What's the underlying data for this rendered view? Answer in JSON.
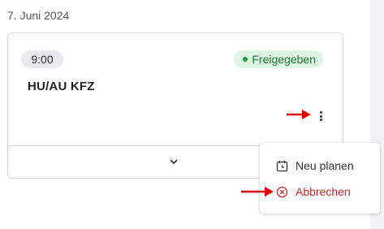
{
  "date_heading": "7. Juni 2024",
  "appointment": {
    "time": "9:00",
    "status": "Freigegeben",
    "title": "HU/AU KFZ"
  },
  "menu": {
    "items": [
      {
        "label": "Neu planen",
        "icon": "calendar-clock-icon"
      },
      {
        "label": "Abbrechen",
        "icon": "circle-x-icon"
      }
    ]
  },
  "colors": {
    "status_bg": "#dff5e4",
    "status_text": "#1e7a36",
    "danger": "#c62828",
    "annotation_arrow": "#e00000"
  }
}
